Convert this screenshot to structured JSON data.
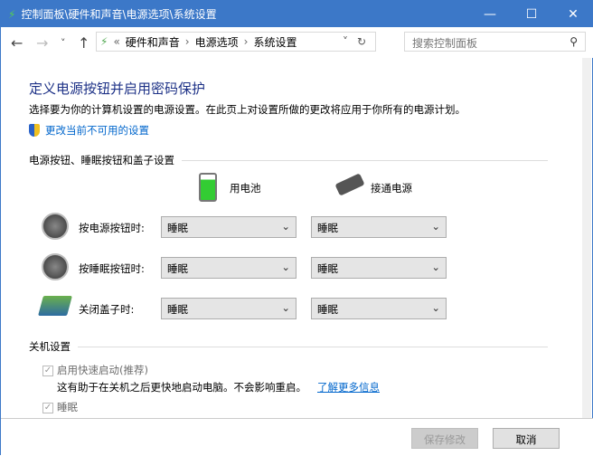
{
  "window": {
    "title": "控制面板\\硬件和声音\\电源选项\\系统设置",
    "minimize": "—",
    "maximize": "☐",
    "close": "✕"
  },
  "nav": {
    "back": "←",
    "forward": "→",
    "recent": "˅",
    "up": "↑",
    "crumbs": [
      "«",
      "硬件和声音",
      "›",
      "电源选项",
      "›",
      "系统设置"
    ],
    "dropdown": "˅",
    "refresh": "↻",
    "search_placeholder": "搜索控制面板",
    "search_icon": "⚲"
  },
  "page": {
    "heading": "定义电源按钮并启用密码保护",
    "desc": "选择要为你的计算机设置的电源设置。在此页上对设置所做的更改将应用于你所有的电源计划。",
    "change_link": "更改当前不可用的设置",
    "section_buttons": "电源按钮、睡眠按钮和盖子设置",
    "col_battery": "用电池",
    "col_ac": "接通电源",
    "rows": [
      {
        "label": "按电源按钮时:",
        "battery": "睡眠",
        "ac": "睡眠"
      },
      {
        "label": "按睡眠按钮时:",
        "battery": "睡眠",
        "ac": "睡眠"
      },
      {
        "label": "关闭盖子时:",
        "battery": "睡眠",
        "ac": "睡眠"
      }
    ],
    "section_shutdown": "关机设置",
    "fast_startup": "启用快速启动(推荐)",
    "fast_desc": "这有助于在关机之后更快地启动电脑。不会影响重启。",
    "learn_more": "了解更多信息",
    "sleep": "睡眠"
  },
  "footer": {
    "save": "保存修改",
    "cancel": "取消"
  }
}
